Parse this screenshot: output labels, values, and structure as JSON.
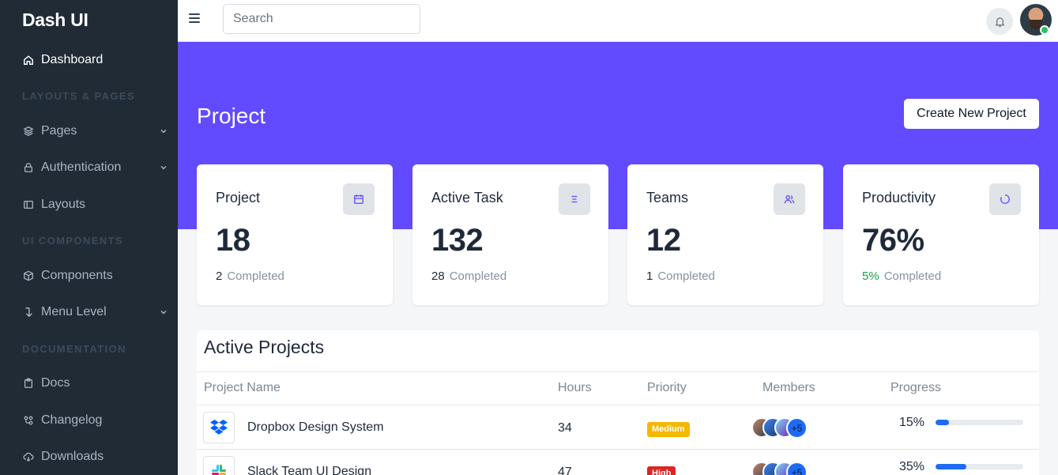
{
  "app": {
    "brand": "Dash UI"
  },
  "sidebar": {
    "dashboard": {
      "label": "Dashboard",
      "icon": "home-icon"
    },
    "heading_layouts": "LAYOUTS & PAGES",
    "pages": {
      "label": "Pages",
      "icon": "layers-icon"
    },
    "authentication": {
      "label": "Authentication",
      "icon": "lock-icon"
    },
    "layouts": {
      "label": "Layouts",
      "icon": "sidebar-icon"
    },
    "heading_ui": "UI COMPONENTS",
    "components": {
      "label": "Components",
      "icon": "package-icon"
    },
    "menu_level": {
      "label": "Menu Level",
      "icon": "arrow-down-icon"
    },
    "heading_docs": "DOCUMENTATION",
    "docs": {
      "label": "Docs",
      "icon": "clipboard-icon"
    },
    "changelog": {
      "label": "Changelog",
      "icon": "git-icon"
    },
    "downloads": {
      "label": "Downloads",
      "icon": "cloud-download-icon"
    }
  },
  "topbar": {
    "search_placeholder": "Search"
  },
  "hero": {
    "title": "Project",
    "create_button": "Create New Project",
    "accent_color": "#624bff"
  },
  "stats": [
    {
      "title": "Project",
      "value": "18",
      "done": "2",
      "done_label": "Completed",
      "icon": "calendar-icon"
    },
    {
      "title": "Active Task",
      "value": "132",
      "done": "28",
      "done_label": "Completed",
      "icon": "list-icon"
    },
    {
      "title": "Teams",
      "value": "12",
      "done": "1",
      "done_label": "Completed",
      "icon": "users-icon"
    },
    {
      "title": "Productivity",
      "value": "76%",
      "done": "5%",
      "done_label": "Completed",
      "icon": "target-icon"
    }
  ],
  "projects": {
    "title": "Active Projects",
    "columns": [
      "Project Name",
      "Hours",
      "Priority",
      "Members",
      "Progress"
    ],
    "rows": [
      {
        "name": "Dropbox Design System",
        "hours": "34",
        "priority": "Medium",
        "priority_color": "#f5b700",
        "members_more": "+5",
        "progress_label": "15%",
        "progress": 15,
        "logo": "dropbox-icon"
      },
      {
        "name": "Slack Team UI Design",
        "hours": "47",
        "priority": "High",
        "priority_color": "#dc2626",
        "members_more": "+5",
        "progress_label": "35%",
        "progress": 35,
        "logo": "slack-icon"
      }
    ]
  }
}
